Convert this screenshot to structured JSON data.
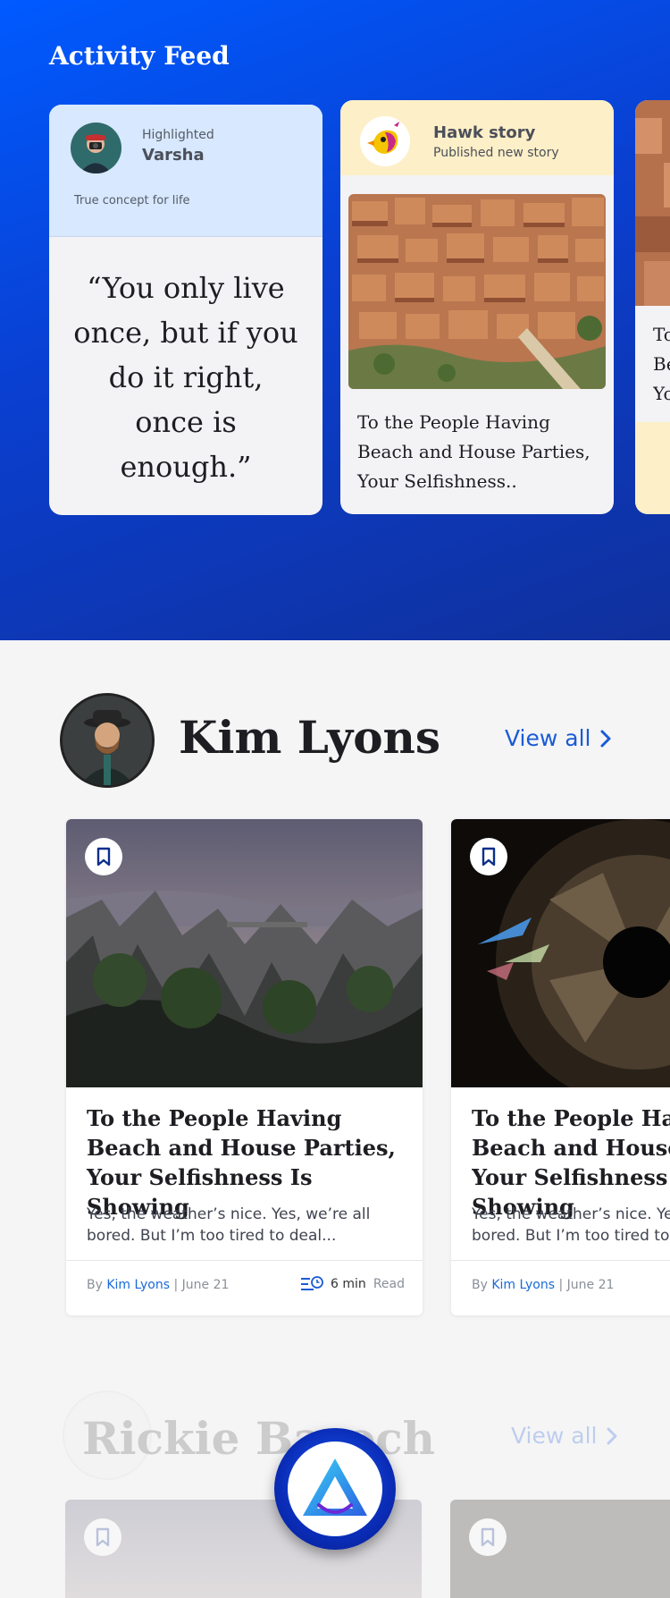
{
  "feed": {
    "title": "Activity Feed",
    "highlight_card": {
      "label": "Highlighted",
      "name": "Varsha",
      "tag": "True concept for life",
      "quote": "“You only live once, but if you do it right, once is enough.”"
    },
    "story_card": {
      "kind": "Hawk story",
      "subtitle": "Published new story",
      "text": "To the People Having Beach and House Parties, Your Selfishness.."
    },
    "peek_card": {
      "text": "To\nBe\nYo"
    }
  },
  "sections": {
    "kim": {
      "author": "Kim Lyons",
      "view_all": "View all",
      "articles": [
        {
          "title": "To the People Having Beach and House Parties, Your Selfishness Is Showing",
          "desc": "Yes, the weather’s nice. Yes, we’re all bored. But I’m too tired to deal...",
          "by": "By",
          "author": "Kim Lyons",
          "date": "| June 21",
          "read_min": "6 min",
          "read_label": "Read"
        },
        {
          "title": "To the People Having Beach and House Parties, Your Selfishness Is Showing",
          "desc": "Yes, the weather’s nice. Yes, we’re all bored. But I’m too tired to deal...",
          "by": "By",
          "author": "Kim Lyons",
          "date": "| June 21"
        }
      ]
    },
    "rickie": {
      "author": "Rickie Baroch",
      "view_all": "View all"
    }
  },
  "colors": {
    "hero_gradient_start": "#005aff",
    "hero_gradient_end": "#10309c",
    "accent": "#1a5bd6",
    "highlight_bg": "#d7e8ff",
    "story_bg": "#fdefc7"
  }
}
